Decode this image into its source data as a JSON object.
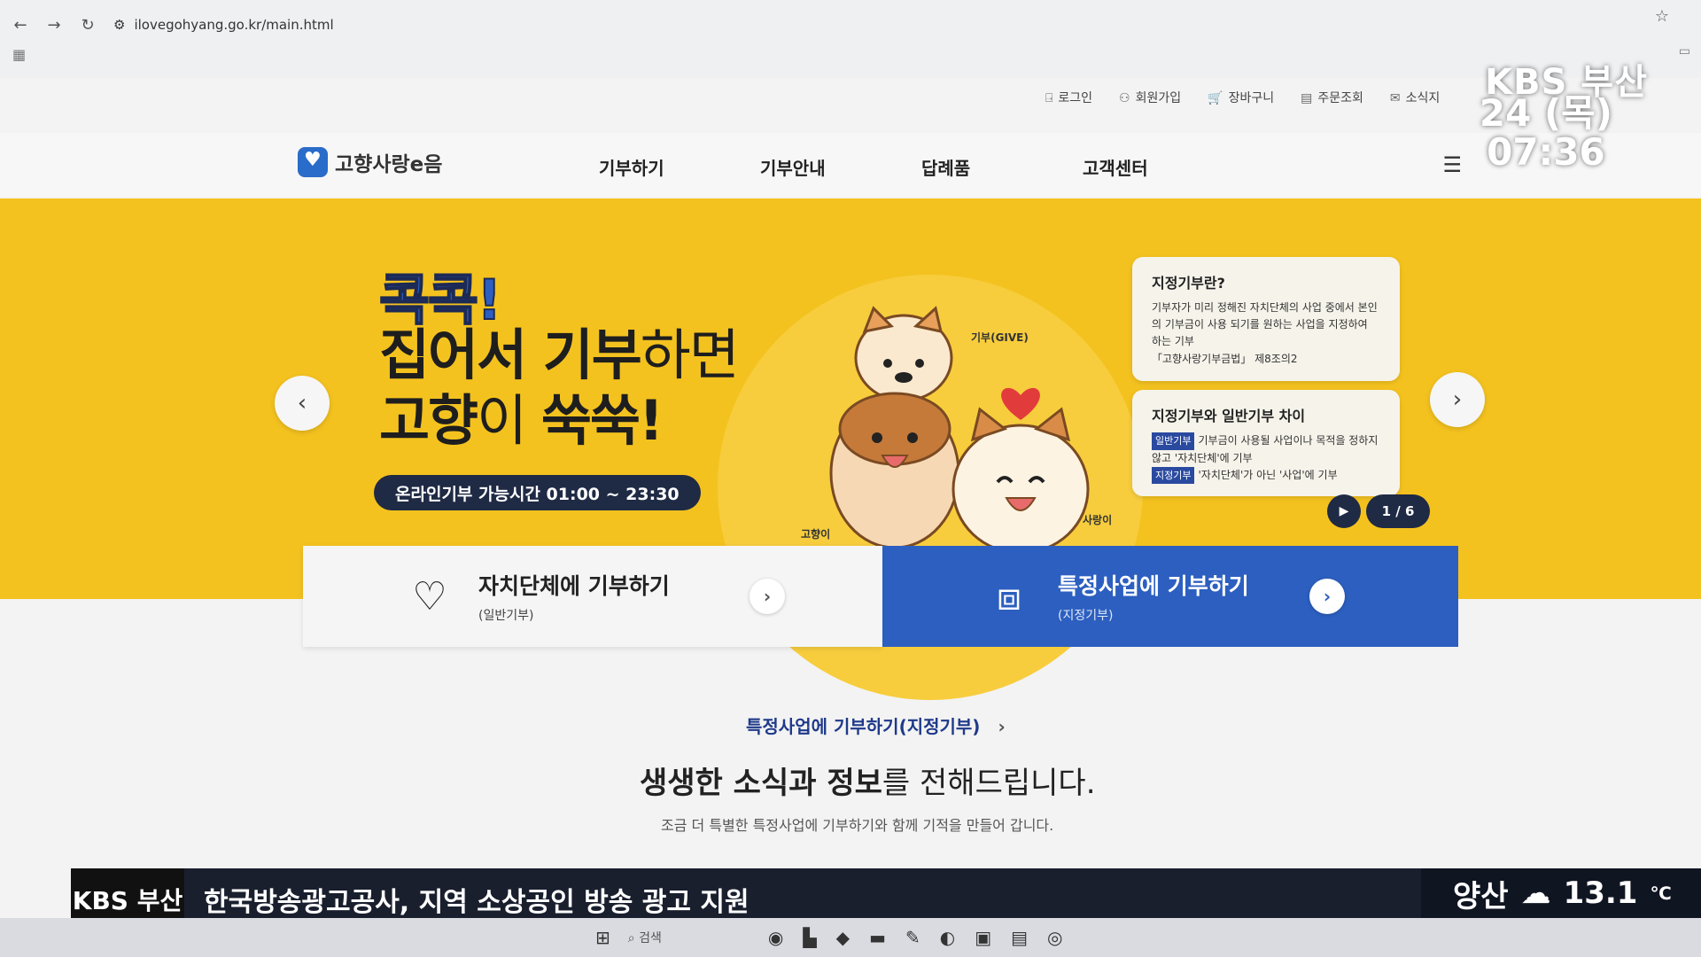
{
  "browser": {
    "url": "ilovegohyang.go.kr/main.html",
    "back_icon": "←",
    "forward_icon": "→",
    "reload_icon": "↻",
    "star_icon": "☆"
  },
  "util_nav": [
    {
      "label": "로그인",
      "icon": "⍈"
    },
    {
      "label": "회원가입",
      "icon": "⚇"
    },
    {
      "label": "장바구니",
      "icon": "🛒"
    },
    {
      "label": "주문조회",
      "icon": "▤"
    },
    {
      "label": "소식지",
      "icon": "✉"
    }
  ],
  "header": {
    "logo_text": "고향사랑e음",
    "menu": [
      "기부하기",
      "기부안내",
      "답례품",
      "고객센터"
    ]
  },
  "hero": {
    "kicker": "콕콕!",
    "line1_bold": "집어서 기부",
    "line1_light": "하면",
    "line2_bold": "고향",
    "line2_light": "이 ",
    "line2_end": "쑥쑥!",
    "hours": "온라인기부 가능시간 01:00 ~ 23:30",
    "mascot_labels": {
      "give": "기부(GIVE)",
      "gohyang": "고향이",
      "sarang": "사랑이"
    },
    "info1": {
      "title": "지정기부란?",
      "body": "기부자가 미리 정해진 자치단체의 사업 중에서 본인의 기부금이 사용 되기를 원하는 사업을 지정하여 하는 기부",
      "note": "「고향사랑기부금법」 제8조의2"
    },
    "info2": {
      "title": "지정기부와 일반기부 차이",
      "tag1": "일반기부",
      "row1": "기부금이 사용될 사업이나 목적을 정하지 않고 '자치단체'에 기부",
      "tag2": "지정기부",
      "row2": "'자치단체'가 아닌 '사업'에 기부"
    },
    "pager": "1 / 6"
  },
  "cta": {
    "general_title": "자치단체에 기부하기",
    "general_sub": "(일반기부)",
    "special_title": "특정사업에 기부하기",
    "special_sub": "(지정기부)"
  },
  "section": {
    "link": "특정사업에 기부하기(지정기부)",
    "title_bold": "생생한 소식과 정보",
    "title_rest": "를 전해드립니다.",
    "desc": "조금 더 특별한 특정사업에 기부하기와 함께 기적을 만들어 갑니다."
  },
  "broadcast": {
    "channel": "KBS 부산",
    "date": "24 (목)",
    "time": "07:36",
    "ticker_brand": "KBS 부산",
    "ticker_text": "한국방송광고공사, 지역 소상공인 방송 광고 지원",
    "weather_city": "양산",
    "weather_temp": "13.1",
    "weather_unit": "℃"
  },
  "taskbar": {
    "search": "검색"
  }
}
